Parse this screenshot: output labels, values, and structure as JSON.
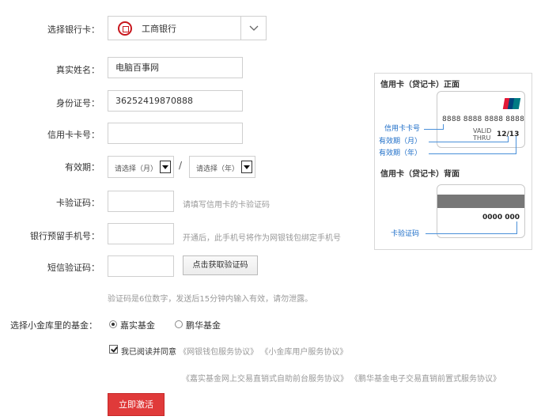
{
  "form": {
    "bank_label": "选择银行卡：",
    "bank_name": "工商银行",
    "name_label": "真实姓名：",
    "name_value": "电脑百事网",
    "id_label": "身份证号：",
    "id_value": "36252419870888",
    "card_label": "信用卡卡号：",
    "expiry_label": "有效期：",
    "month_placeholder": "请选择（月）",
    "year_placeholder": "请选择（年）",
    "slash": "/",
    "cvv_label": "卡验证码：",
    "cvv_hint": "请填写信用卡的卡验证码",
    "phone_label": "银行预留手机号：",
    "phone_hint": "开通后，此手机号将作为网银钱包绑定手机号",
    "sms_label": "短信验证码：",
    "sms_button": "点击获取验证码",
    "sms_hint": "验证码是6位数字，发送后15分钟内输入有效，请勿泄露。",
    "fund_label": "选择小金库里的基金：",
    "fund_options": [
      "嘉实基金",
      "鹏华基金"
    ],
    "agree_text": "我已阅读并同意",
    "agreement_1": "《网银钱包服务协议》",
    "agreement_2": "《小金库用户服务协议》",
    "agreement_3": "《嘉实基金网上交易直销式自助前台服务协议》",
    "agreement_4": "《鹏华基金电子交易直销前置式服务协议》",
    "activate_button": "立即激活"
  },
  "card_help": {
    "front_title": "信用卡（贷记卡）正面",
    "back_title": "信用卡（贷记卡）背面",
    "card_number": "8888 8888 8888 8888",
    "valid_line1": "VALID",
    "valid_line2": "THRU",
    "expiry": "12/13",
    "label_card_number": "信用卡卡号",
    "label_month": "有效期（月）",
    "label_year": "有效期（年）",
    "back_code": "0000 000",
    "label_cvv": "卡验证码"
  },
  "colors": {
    "accent_red": "#e03a3a",
    "bank_red": "#c8161d",
    "annotation_blue": "#1e6ec8",
    "unionpay": [
      "#e21836",
      "#00447c",
      "#007b84"
    ]
  }
}
